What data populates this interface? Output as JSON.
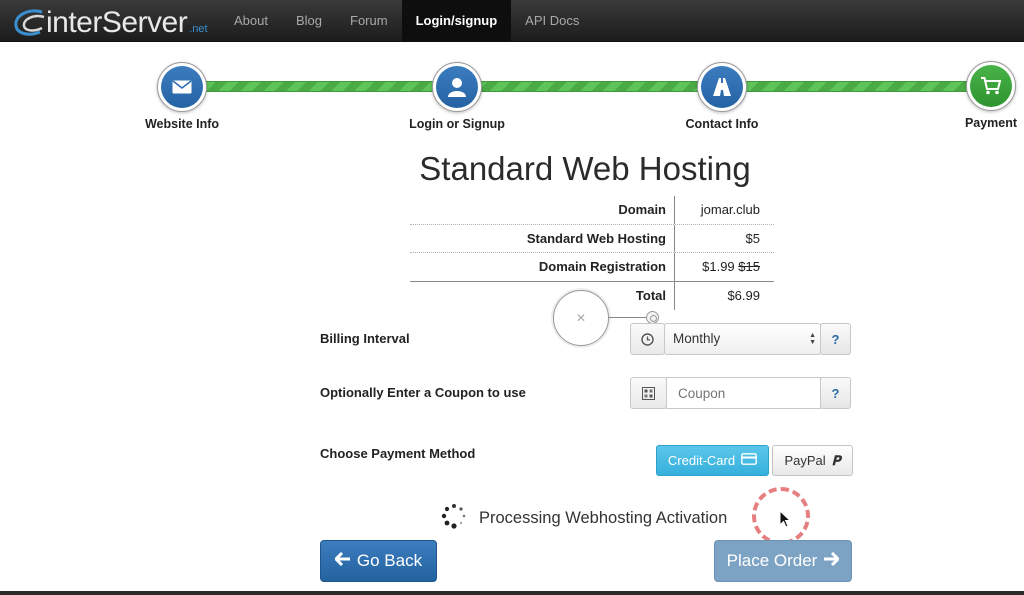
{
  "logo": {
    "text": "interServer",
    "tld": ".net"
  },
  "nav": {
    "items": [
      {
        "label": "About"
      },
      {
        "label": "Blog"
      },
      {
        "label": "Forum"
      },
      {
        "label": "Login/signup",
        "active": true
      },
      {
        "label": "API Docs"
      }
    ]
  },
  "steps": [
    {
      "label": "Website Info",
      "icon": "envelope-icon"
    },
    {
      "label": "Login or Signup",
      "icon": "user-icon"
    },
    {
      "label": "Contact Info",
      "icon": "road-icon"
    },
    {
      "label": "Payment",
      "icon": "cart-icon"
    }
  ],
  "title": "Standard Web Hosting",
  "summary": {
    "rows": [
      {
        "label": "Domain",
        "value": "jomar.club"
      },
      {
        "label": "Standard Web Hosting",
        "value": "$5"
      },
      {
        "label": "Domain Registration",
        "value": "$1.99",
        "old_value": "$15"
      },
      {
        "label": "Total",
        "value": "$6.99"
      }
    ]
  },
  "billing": {
    "label": "Billing Interval",
    "selected": "Monthly",
    "help": "?"
  },
  "coupon": {
    "label": "Optionally Enter a Coupon to use",
    "placeholder": "Coupon",
    "help": "?"
  },
  "payment": {
    "label": "Choose Payment Method",
    "credit_card": "Credit-Card",
    "paypal": "PayPal"
  },
  "status": {
    "text": "Processing Webhosting Activation"
  },
  "actions": {
    "back": "Go Back",
    "place_order": "Place Order"
  },
  "colors": {
    "progress_green": "#5ec45a",
    "step_blue": "#2f6fb1",
    "credit_card_button": "#46bce3",
    "place_order_disabled": "#7da3c4"
  }
}
